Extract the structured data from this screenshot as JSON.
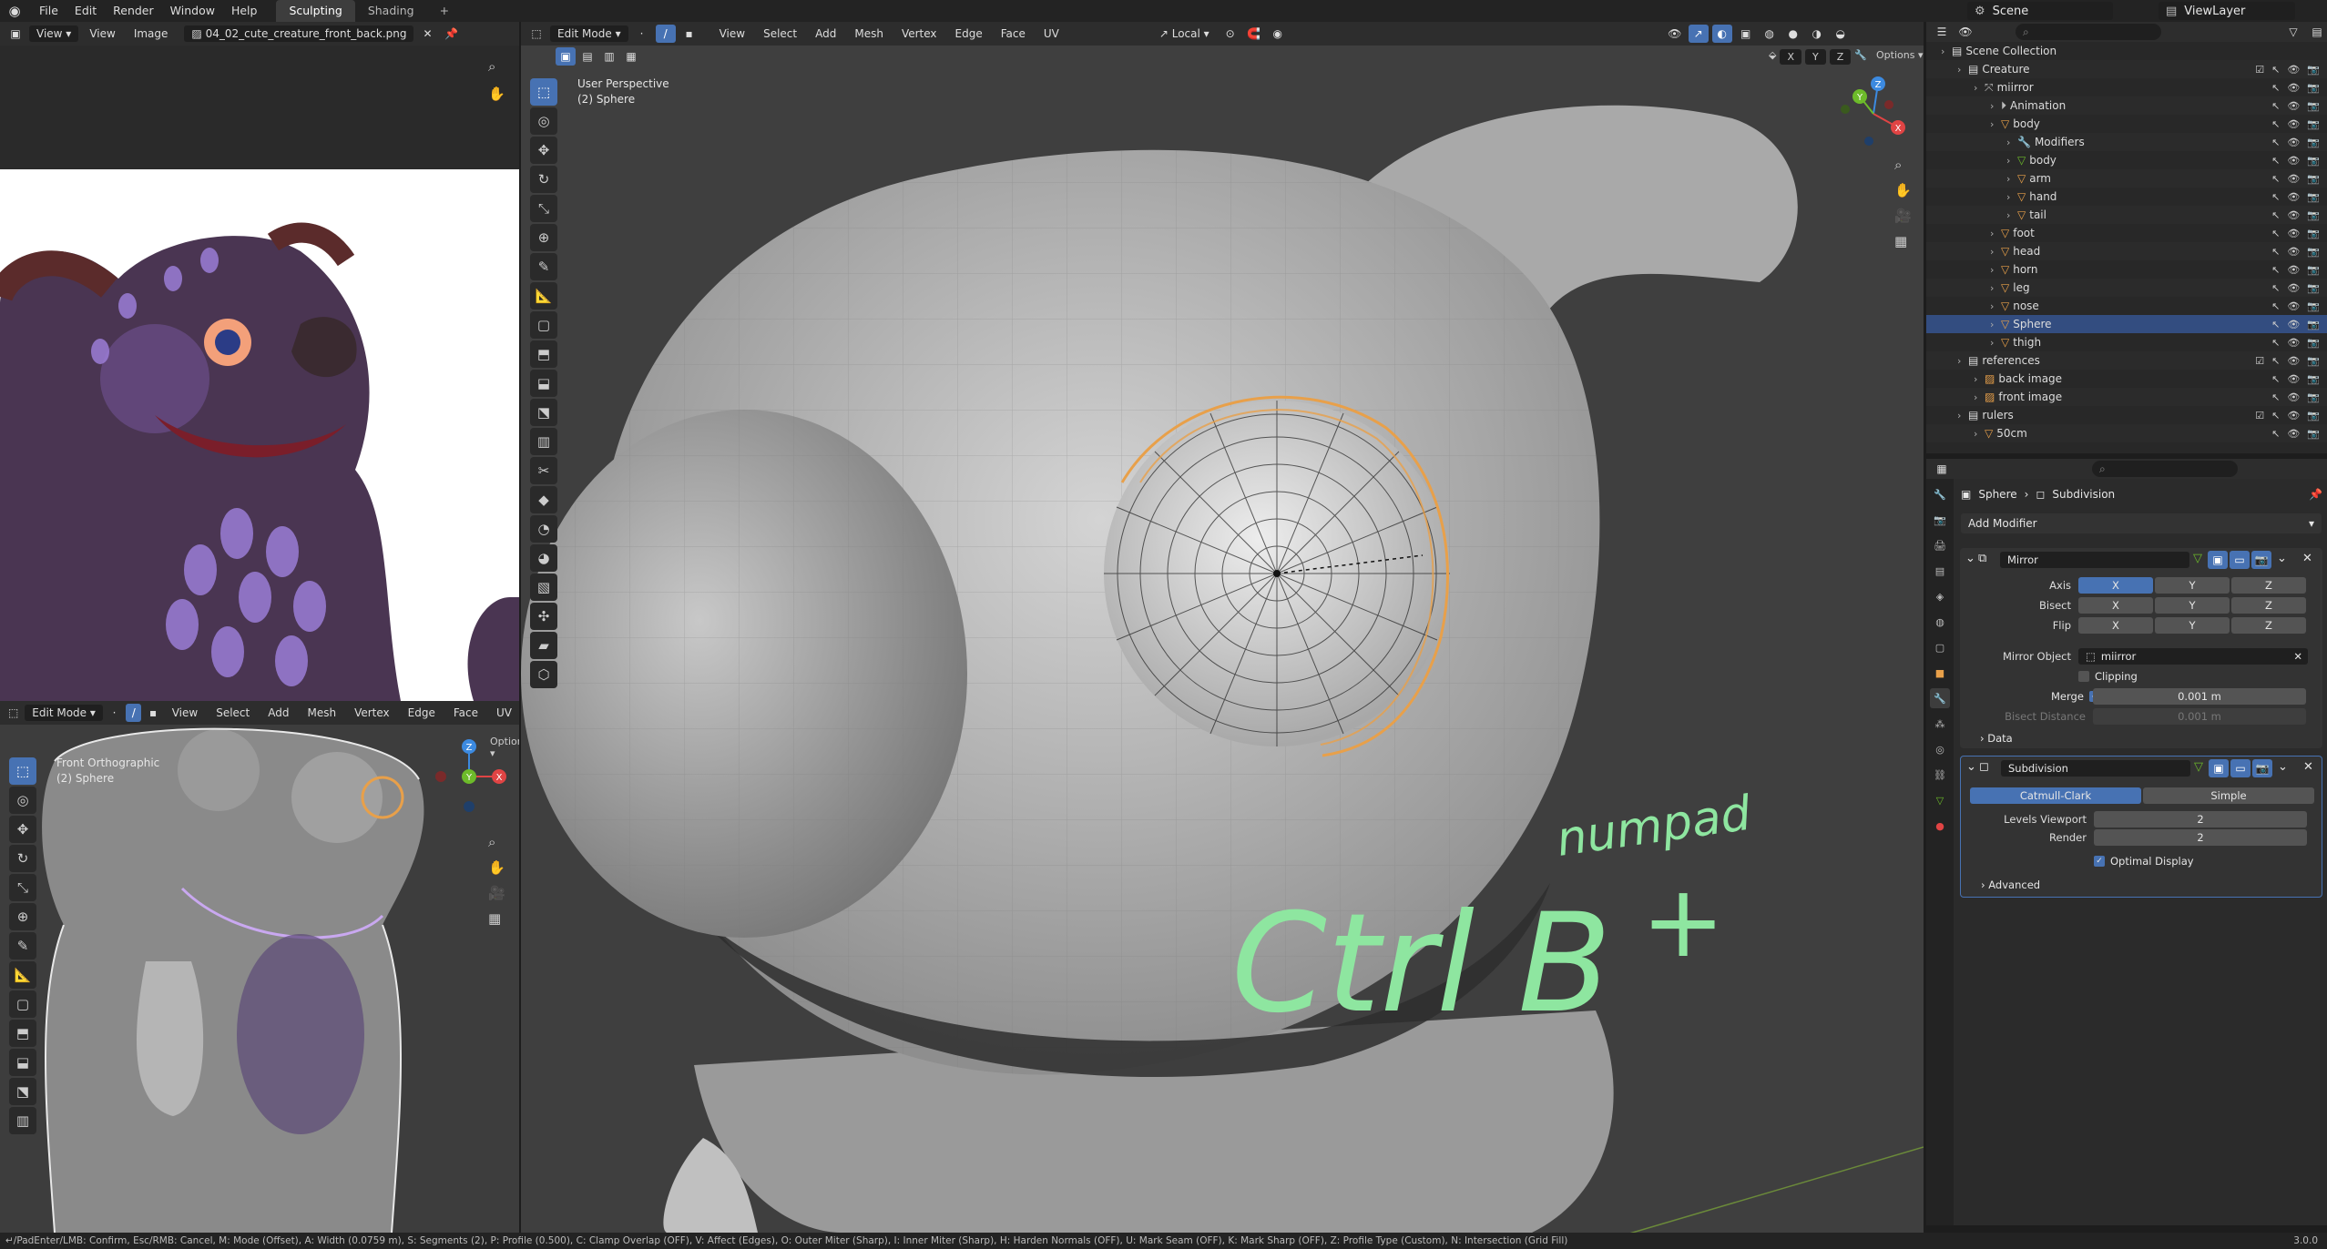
{
  "topbar": {
    "menus": [
      "File",
      "Edit",
      "Render",
      "Window",
      "Help"
    ],
    "workspaces": [
      "Sculpting",
      "Shading"
    ],
    "active_workspace": "Sculpting",
    "add_tab": "+",
    "scene": "Scene",
    "view_layer": "ViewLayer"
  },
  "image_editor": {
    "view": "View",
    "view2": "View",
    "image": "Image",
    "filename": "04_02_cute_creature_front_back.png"
  },
  "viewport_main": {
    "mode": "Edit Mode",
    "menus": [
      "View",
      "Select",
      "Add",
      "Mesh",
      "Vertex",
      "Edge",
      "Face",
      "UV"
    ],
    "orientation": "Local",
    "options": "Options",
    "overlay_line1": "User Perspective",
    "overlay_line2": "(2) Sphere",
    "axis_x": "X",
    "axis_y": "Y",
    "axis_z": "Z",
    "annotation_main": "Ctrl B",
    "annotation_plus": "+",
    "annotation_small": "numpad"
  },
  "viewport_front": {
    "mode": "Edit Mode",
    "menus": [
      "View",
      "Select",
      "Add",
      "Mesh",
      "Vertex",
      "Edge",
      "Face",
      "UV"
    ],
    "options": "Options",
    "overlay_line1": "Front Orthographic",
    "overlay_line2": "(2) Sphere",
    "axis_x": "X",
    "axis_y": "Y",
    "axis_z": "Z"
  },
  "outliner": {
    "rows": [
      {
        "label": "Scene Collection",
        "indent": 0,
        "icon": "collection"
      },
      {
        "label": "Creature",
        "indent": 1,
        "icon": "collection",
        "check": true
      },
      {
        "label": "miirror",
        "indent": 2,
        "icon": "empty"
      },
      {
        "label": "Animation",
        "indent": 3,
        "icon": "anim"
      },
      {
        "label": "body",
        "indent": 3,
        "icon": "mesh"
      },
      {
        "label": "Modifiers",
        "indent": 4,
        "icon": "wrench"
      },
      {
        "label": "body",
        "indent": 4,
        "icon": "meshdata"
      },
      {
        "label": "arm",
        "indent": 4,
        "icon": "mesh"
      },
      {
        "label": "hand",
        "indent": 4,
        "icon": "mesh"
      },
      {
        "label": "tail",
        "indent": 4,
        "icon": "mesh"
      },
      {
        "label": "foot",
        "indent": 3,
        "icon": "mesh"
      },
      {
        "label": "head",
        "indent": 3,
        "icon": "mesh"
      },
      {
        "label": "horn",
        "indent": 3,
        "icon": "mesh"
      },
      {
        "label": "leg",
        "indent": 3,
        "icon": "mesh"
      },
      {
        "label": "nose",
        "indent": 3,
        "icon": "mesh"
      },
      {
        "label": "Sphere",
        "indent": 3,
        "icon": "mesh",
        "selected": true
      },
      {
        "label": "thigh",
        "indent": 3,
        "icon": "mesh"
      },
      {
        "label": "references",
        "indent": 1,
        "icon": "collection",
        "check": true
      },
      {
        "label": "back image",
        "indent": 2,
        "icon": "image"
      },
      {
        "label": "front image",
        "indent": 2,
        "icon": "image"
      },
      {
        "label": "rulers",
        "indent": 1,
        "icon": "collection",
        "check": true
      },
      {
        "label": "50cm",
        "indent": 2,
        "icon": "mesh"
      }
    ]
  },
  "properties": {
    "breadcrumb_obj": "Sphere",
    "breadcrumb_mod": "Subdivision",
    "add_modifier": "Add Modifier",
    "mirror": {
      "name": "Mirror",
      "axis_label": "Axis",
      "bisect_label": "Bisect",
      "flip_label": "Flip",
      "x": "X",
      "y": "Y",
      "z": "Z",
      "mirror_object_label": "Mirror Object",
      "mirror_object_value": "miirror",
      "clipping_label": "Clipping",
      "merge_label": "Merge",
      "merge_value": "0.001 m",
      "bisect_distance_label": "Bisect Distance",
      "bisect_distance_value": "0.001 m",
      "data_label": "Data"
    },
    "subdivision": {
      "name": "Subdivision",
      "catmull": "Catmull-Clark",
      "simple": "Simple",
      "levels_viewport_label": "Levels Viewport",
      "levels_viewport_value": "2",
      "render_label": "Render",
      "render_value": "2",
      "optimal_label": "Optimal Display",
      "advanced_label": "Advanced"
    }
  },
  "statusbar": {
    "text": "↵/PadEnter/LMB: Confirm, Esc/RMB: Cancel, M: Mode (Offset), A: Width (0.0759 m), S: Segments (2), P: Profile (0.500), C: Clamp Overlap (OFF), V: Affect (Edges), O: Outer Miter (Sharp), I: Inner Miter (Sharp), H: Harden Normals (OFF), U: Mark Seam (OFF), K: Mark Sharp (OFF), Z: Profile Type (Custom), N: Intersection (Grid Fill)",
    "version": "3.0.0"
  },
  "colors": {
    "accent": "#4772b3",
    "annotation": "#8ee6a0",
    "selection_edge": "#e8a04a",
    "axis_x": "#e04444",
    "axis_y": "#6dbb2a",
    "axis_z": "#3c8ae0"
  }
}
